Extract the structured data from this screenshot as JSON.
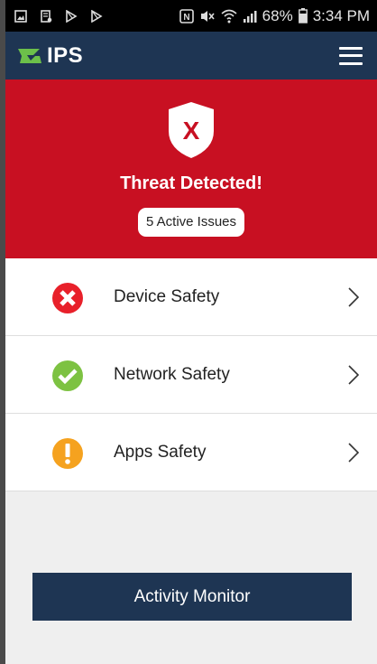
{
  "status_bar": {
    "battery": "68%",
    "time": "3:34 PM",
    "icons": [
      "gallery-icon",
      "document-icon",
      "play-store-icon",
      "play-store-icon",
      "nfc-icon",
      "mute-icon",
      "wifi-icon",
      "signal-icon",
      "battery-icon"
    ]
  },
  "header": {
    "logo_text": "IPS",
    "logo_accent_color": "#6cc04a",
    "background_color": "#1e3553",
    "menu_icon": "hamburger-menu-icon"
  },
  "banner": {
    "background_color": "#c81022",
    "shield_icon": "shield-x-icon",
    "shield_mark": "X",
    "title": "Threat Detected!",
    "issues_label": "5 Active Issues"
  },
  "safety_items": [
    {
      "label": "Device Safety",
      "status": "danger",
      "icon": "error-x-icon",
      "color": "#e8202a"
    },
    {
      "label": "Network Safety",
      "status": "ok",
      "icon": "check-icon",
      "color": "#7dc242"
    },
    {
      "label": "Apps Safety",
      "status": "warning",
      "icon": "warning-exclamation-icon",
      "color": "#f5a21f"
    }
  ],
  "activity_button": {
    "label": "Activity Monitor"
  }
}
